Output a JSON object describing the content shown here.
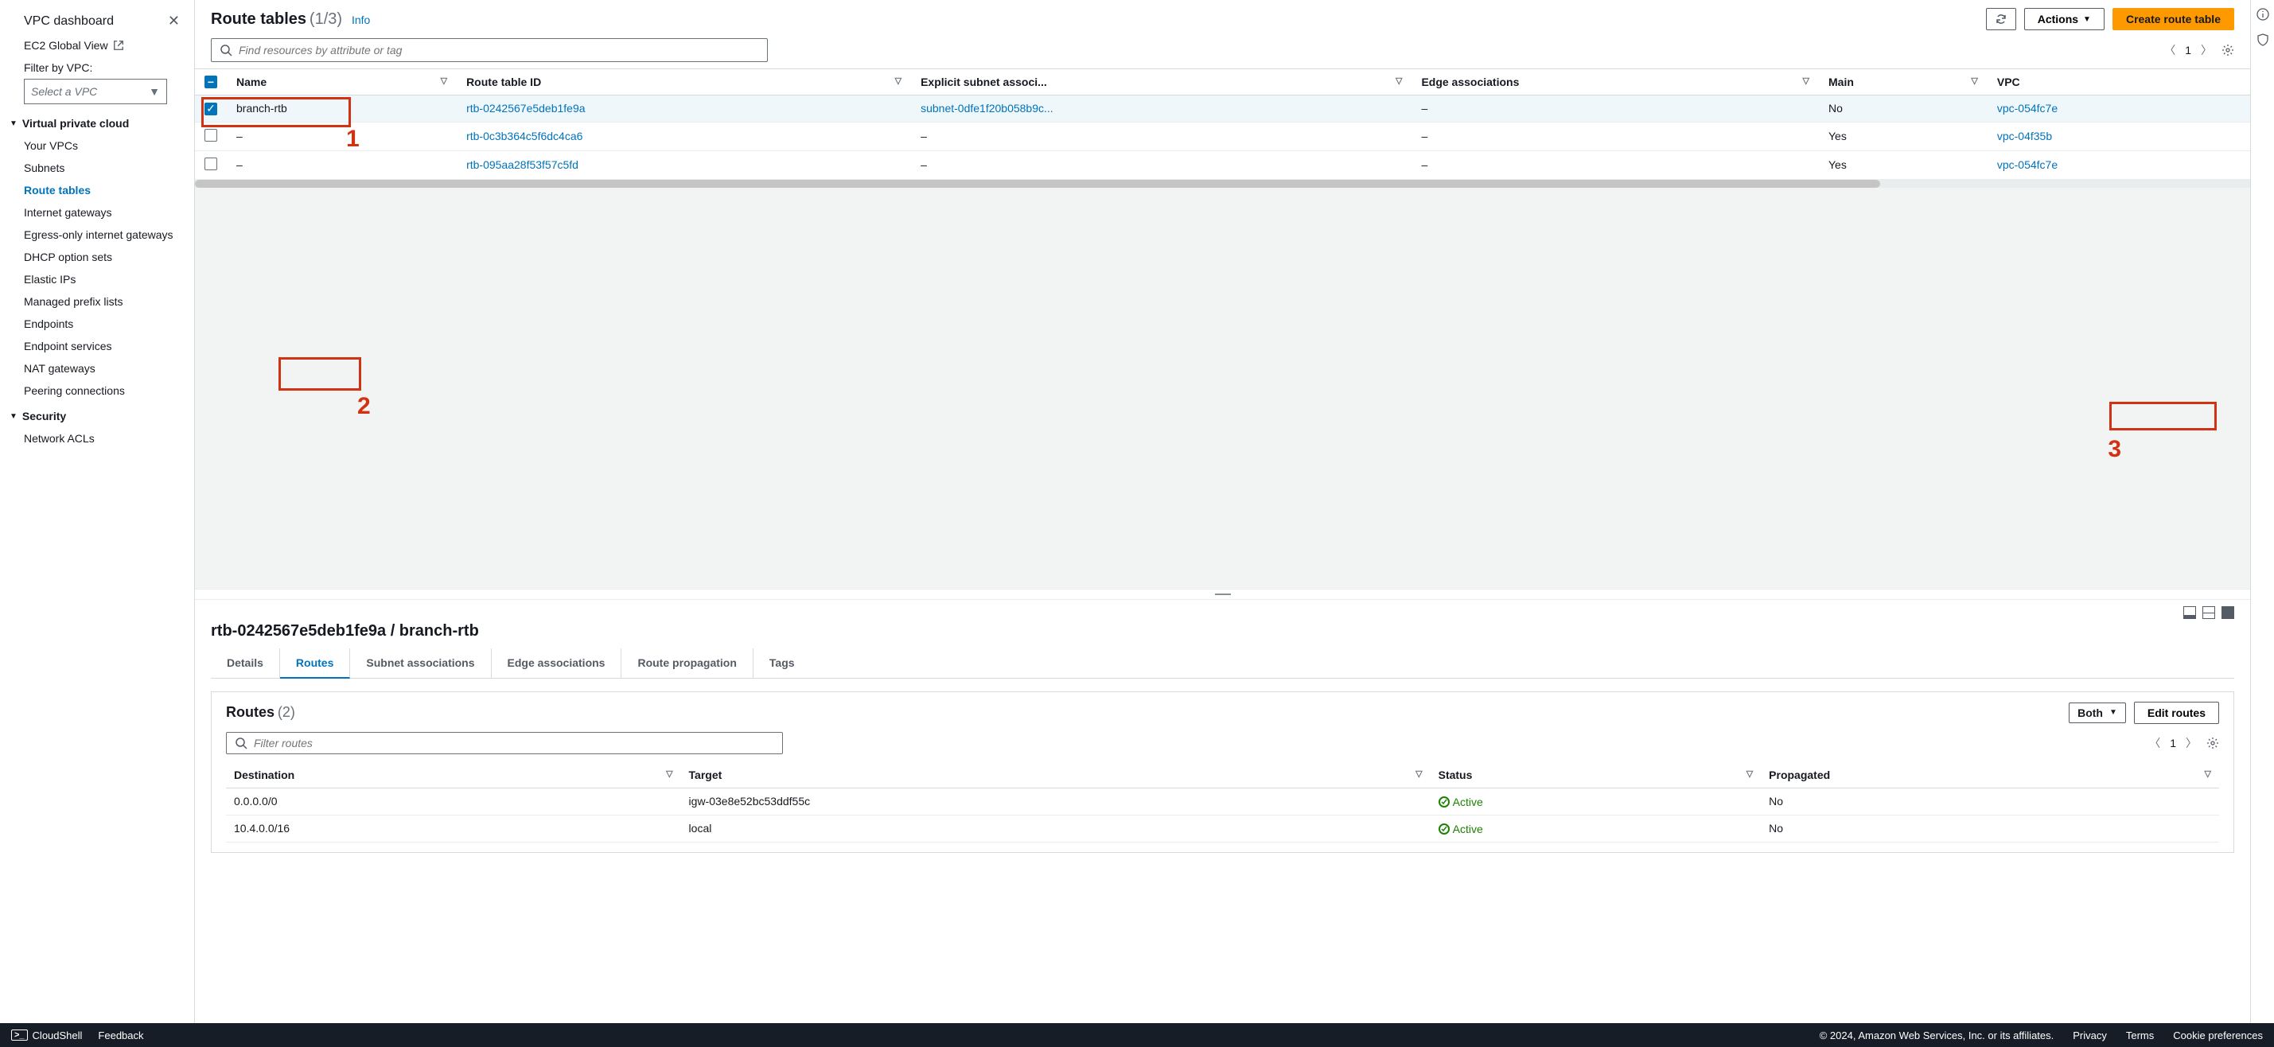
{
  "sidebar": {
    "dashboard": "VPC dashboard",
    "globalView": "EC2 Global View",
    "filterLabel": "Filter by VPC:",
    "selectPlaceholder": "Select a VPC",
    "group1": {
      "title": "Virtual private cloud",
      "items": [
        "Your VPCs",
        "Subnets",
        "Route tables",
        "Internet gateways",
        "Egress-only internet gateways",
        "DHCP option sets",
        "Elastic IPs",
        "Managed prefix lists",
        "Endpoints",
        "Endpoint services",
        "NAT gateways",
        "Peering connections"
      ]
    },
    "group2": {
      "title": "Security",
      "items": [
        "Network ACLs"
      ]
    }
  },
  "header": {
    "title": "Route tables",
    "count": "(1/3)",
    "info": "Info",
    "actions": "Actions",
    "create": "Create route table"
  },
  "search": {
    "placeholder": "Find resources by attribute or tag",
    "page": "1"
  },
  "columns": {
    "name": "Name",
    "rtid": "Route table ID",
    "subnet": "Explicit subnet associ...",
    "edge": "Edge associations",
    "main": "Main",
    "vpc": "VPC"
  },
  "rows": [
    {
      "checked": true,
      "name": "branch-rtb",
      "rtid": "rtb-0242567e5deb1fe9a",
      "subnet": "subnet-0dfe1f20b058b9c...",
      "edge": "–",
      "main": "No",
      "vpc": "vpc-054fc7e"
    },
    {
      "checked": false,
      "name": "–",
      "rtid": "rtb-0c3b364c5f6dc4ca6",
      "subnet": "–",
      "edge": "–",
      "main": "Yes",
      "vpc": "vpc-04f35b"
    },
    {
      "checked": false,
      "name": "–",
      "rtid": "rtb-095aa28f53f57c5fd",
      "subnet": "–",
      "edge": "–",
      "main": "Yes",
      "vpc": "vpc-054fc7e"
    }
  ],
  "detail": {
    "title": "rtb-0242567e5deb1fe9a / branch-rtb",
    "tabs": [
      "Details",
      "Routes",
      "Subnet associations",
      "Edge associations",
      "Route propagation",
      "Tags"
    ],
    "routes": {
      "title": "Routes",
      "count": "(2)",
      "filterBoth": "Both",
      "editBtn": "Edit routes",
      "filterPlaceholder": "Filter routes",
      "page": "1",
      "cols": {
        "dest": "Destination",
        "target": "Target",
        "status": "Status",
        "prop": "Propagated"
      },
      "rows": [
        {
          "dest": "0.0.0.0/0",
          "target": "igw-03e8e52bc53ddf55c",
          "targetLink": true,
          "status": "Active",
          "prop": "No"
        },
        {
          "dest": "10.4.0.0/16",
          "target": "local",
          "targetLink": false,
          "status": "Active",
          "prop": "No"
        }
      ]
    }
  },
  "footer": {
    "cloudshell": "CloudShell",
    "feedback": "Feedback",
    "copyright": "© 2024, Amazon Web Services, Inc. or its affiliates.",
    "privacy": "Privacy",
    "terms": "Terms",
    "cookies": "Cookie preferences"
  },
  "annotations": {
    "a1": "1",
    "a2": "2",
    "a3": "3"
  }
}
